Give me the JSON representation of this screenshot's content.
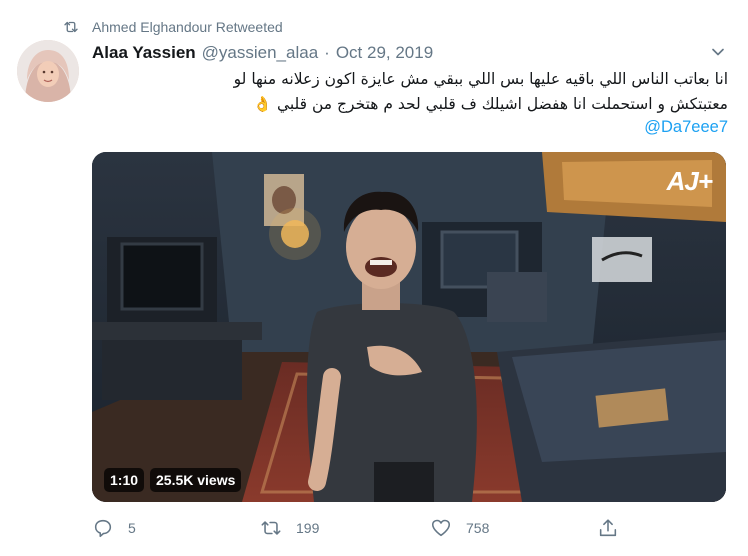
{
  "retweet": {
    "by": "Ahmed Elghandour Retweeted"
  },
  "author": {
    "name": "Alaa Yassien",
    "handle": "@yassien_alaa",
    "separator": "·",
    "date": "Oct 29, 2019"
  },
  "tweet": {
    "line1": "انا بعاتب الناس اللي باقيه عليها بس اللي ببقي مش عايزة اكون زعلانه منها لو",
    "line2": "معتبتكش و استحملت انا هفضل اشيلك ف قلبي لحد م هتخرج من قلبي",
    "emoji": "👌",
    "mention": "@Da7eee7"
  },
  "media": {
    "duration": "1:10",
    "views": "25.5K views",
    "logo": "AJ+"
  },
  "actions": {
    "replies": "5",
    "retweets": "199",
    "likes": "758"
  },
  "colors": {
    "accent": "#1da1f2",
    "muted": "#657786",
    "text": "#14171a"
  },
  "icons": [
    "retweet-icon",
    "chevron-down-icon",
    "reply-icon",
    "like-icon",
    "share-icon"
  ]
}
